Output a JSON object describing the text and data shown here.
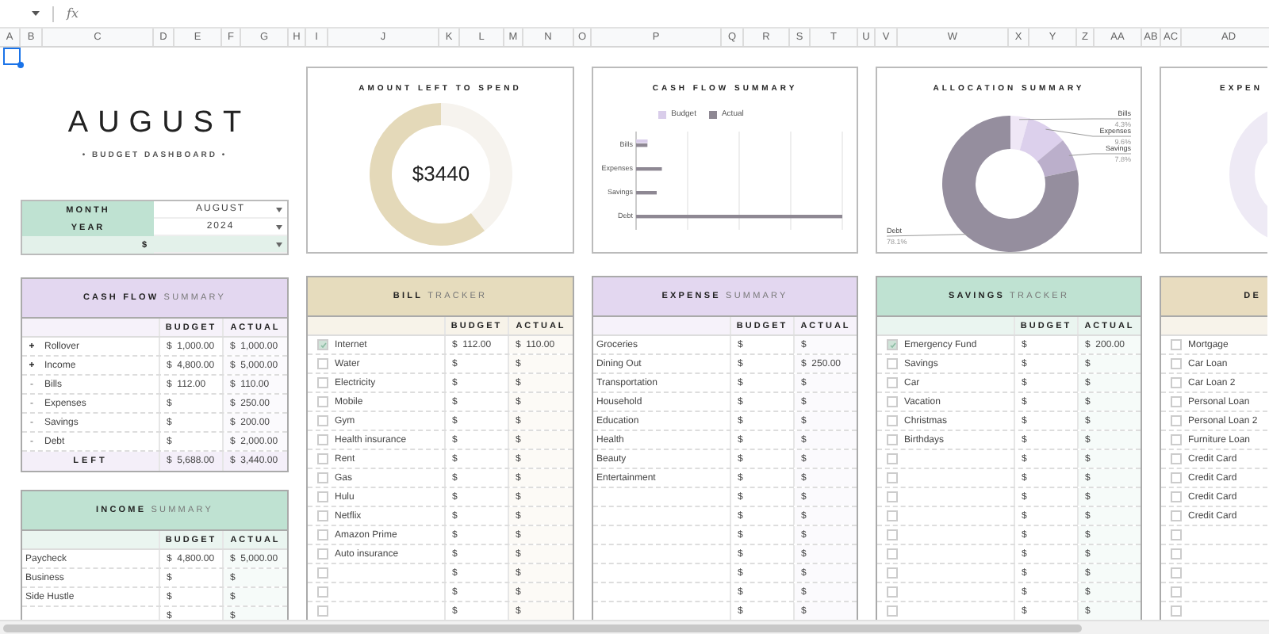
{
  "toolbar": {
    "formula_label": "fx"
  },
  "column_headers": [
    "A",
    "B",
    "C",
    "D",
    "E",
    "F",
    "G",
    "H",
    "I",
    "J",
    "K",
    "L",
    "M",
    "N",
    "O",
    "P",
    "Q",
    "R",
    "S",
    "T",
    "U",
    "V",
    "W",
    "X",
    "Y",
    "Z",
    "AA",
    "AB",
    "AC",
    "AD"
  ],
  "dashboard": {
    "title": "AUGUST",
    "subtitle": "• BUDGET DASHBOARD •",
    "selector": [
      {
        "kind": "field",
        "label": "MONTH",
        "value": "AUGUST"
      },
      {
        "kind": "field",
        "label": "YEAR",
        "value": "2024"
      },
      {
        "kind": "currency",
        "label": "$"
      }
    ]
  },
  "amount_card": {
    "title": "AMOUNT LEFT TO SPEND",
    "amount": "$3440"
  },
  "cashflow_chart": {
    "title": "CASH FLOW SUMMARY",
    "categories": [
      "Bills",
      "Expenses",
      "Savings",
      "Debt"
    ],
    "legend": [
      {
        "name": "Budget",
        "color": "#d9cdea"
      },
      {
        "name": "Actual",
        "color": "#8e8893"
      }
    ]
  },
  "allocation_chart": {
    "chart_data": {
      "type": "donut",
      "title": "ALLOCATION SUMMARY",
      "categories": [
        "Bills",
        "Expenses",
        "Savings",
        "Debt"
      ],
      "values": [
        4.3,
        9.6,
        7.8,
        78.1
      ],
      "value_labels": [
        "4.3%",
        "9.6%",
        "7.8%",
        "78.1%"
      ]
    }
  },
  "expense_chart": {
    "title": "EXPEN"
  },
  "tables": [
    {
      "kind": "summary",
      "color": "#e3d7f0",
      "title": "**CASH FLOW** SUMMARY",
      "columns": [
        "BUDGET",
        "ACTUAL"
      ],
      "rows": [
        {
          "marker": "+",
          "label": "Rollover",
          "budget": "$  1,000.00",
          "actual": "$  1,000.00"
        },
        {
          "marker": "+",
          "label": "Income",
          "budget": "$  4,800.00",
          "actual": "$  5,000.00"
        },
        {
          "marker": "-",
          "label": "Bills",
          "budget": "$  112.00",
          "actual": "$  110.00"
        },
        {
          "marker": "-",
          "label": "Expenses",
          "budget": "$",
          "actual": "$  250.00"
        },
        {
          "marker": "-",
          "label": "Savings",
          "budget": "$",
          "actual": "$  200.00"
        },
        {
          "marker": "-",
          "label": "Debt",
          "budget": "$",
          "actual": "$  2,000.00"
        }
      ],
      "footer": {
        "label": "LEFT",
        "budget": "$  5,688.00",
        "actual": "$  3,440.00"
      }
    },
    {
      "kind": "summary",
      "color": "#bfe2d2",
      "title": "**INCOME** SUMMARY",
      "columns": [
        "BUDGET",
        "ACTUAL"
      ],
      "rows": [
        {
          "label": "Paycheck",
          "budget": "$  4,800.00",
          "actual": "$  5,000.00"
        },
        {
          "label": "Business",
          "budget": "$",
          "actual": "$"
        },
        {
          "label": "Side Hustle",
          "budget": "$",
          "actual": "$"
        },
        {
          "budget": "$",
          "actual": "$"
        }
      ]
    },
    {
      "kind": "tracker",
      "color": "#e6dcbd",
      "title": "**BILL** TRACKER",
      "columns": [
        "BUDGET",
        "ACTUAL"
      ],
      "rows": [
        {
          "checked": true,
          "label": "Internet",
          "budget": "$  112.00",
          "actual": "$  110.00"
        },
        {
          "checked": false,
          "label": "Water",
          "budget": "$",
          "actual": "$"
        },
        {
          "checked": false,
          "label": "Electricity",
          "budget": "$",
          "actual": "$"
        },
        {
          "checked": false,
          "label": "Mobile",
          "budget": "$",
          "actual": "$"
        },
        {
          "checked": false,
          "label": "Gym",
          "budget": "$",
          "actual": "$"
        },
        {
          "checked": false,
          "label": "Health insurance",
          "budget": "$",
          "actual": "$"
        },
        {
          "checked": false,
          "label": "Rent",
          "budget": "$",
          "actual": "$"
        },
        {
          "checked": false,
          "label": "Gas",
          "budget": "$",
          "actual": "$"
        },
        {
          "checked": false,
          "label": "Hulu",
          "budget": "$",
          "actual": "$"
        },
        {
          "checked": false,
          "label": "Netflix",
          "budget": "$",
          "actual": "$"
        },
        {
          "checked": false,
          "label": "Amazon Prime",
          "budget": "$",
          "actual": "$"
        },
        {
          "checked": false,
          "label": "Auto insurance",
          "budget": "$",
          "actual": "$"
        },
        {
          "checked": false,
          "budget": "$",
          "actual": "$"
        },
        {
          "checked": false,
          "budget": "$",
          "actual": "$"
        },
        {
          "checked": false,
          "budget": "$",
          "actual": "$"
        }
      ]
    },
    {
      "kind": "summary",
      "color": "#e3d7f0",
      "title": "**EXPENSE** SUMMARY",
      "columns": [
        "BUDGET",
        "ACTUAL"
      ],
      "rows": [
        {
          "label": "Groceries",
          "budget": "$",
          "actual": "$"
        },
        {
          "label": "Dining Out",
          "budget": "$",
          "actual": "$  250.00"
        },
        {
          "label": "Transportation",
          "budget": "$",
          "actual": "$"
        },
        {
          "label": "Household",
          "budget": "$",
          "actual": "$"
        },
        {
          "label": "Education",
          "budget": "$",
          "actual": "$"
        },
        {
          "label": "Health",
          "budget": "$",
          "actual": "$"
        },
        {
          "label": "Beauty",
          "budget": "$",
          "actual": "$"
        },
        {
          "label": "Entertainment",
          "budget": "$",
          "actual": "$"
        },
        {
          "budget": "$",
          "actual": "$"
        },
        {
          "budget": "$",
          "actual": "$"
        },
        {
          "budget": "$",
          "actual": "$"
        },
        {
          "budget": "$",
          "actual": "$"
        },
        {
          "budget": "$",
          "actual": "$"
        },
        {
          "budget": "$",
          "actual": "$"
        },
        {
          "budget": "$",
          "actual": "$"
        }
      ]
    },
    {
      "kind": "tracker",
      "color": "#bfe2d2",
      "title": "**SAVINGS** TRACKER",
      "columns": [
        "BUDGET",
        "ACTUAL"
      ],
      "rows": [
        {
          "checked": true,
          "label": "Emergency Fund",
          "budget": "$",
          "actual": "$  200.00"
        },
        {
          "checked": false,
          "label": "Savings",
          "budget": "$",
          "actual": "$"
        },
        {
          "checked": false,
          "label": "Car",
          "budget": "$",
          "actual": "$"
        },
        {
          "checked": false,
          "label": "Vacation",
          "budget": "$",
          "actual": "$"
        },
        {
          "checked": false,
          "label": "Christmas",
          "budget": "$",
          "actual": "$"
        },
        {
          "checked": false,
          "label": "Birthdays",
          "budget": "$",
          "actual": "$"
        },
        {
          "checked": false,
          "budget": "$",
          "actual": "$"
        },
        {
          "checked": false,
          "budget": "$",
          "actual": "$"
        },
        {
          "checked": false,
          "budget": "$",
          "actual": "$"
        },
        {
          "checked": false,
          "budget": "$",
          "actual": "$"
        },
        {
          "checked": false,
          "budget": "$",
          "actual": "$"
        },
        {
          "checked": false,
          "budget": "$",
          "actual": "$"
        },
        {
          "checked": false,
          "budget": "$",
          "actual": "$"
        },
        {
          "checked": false,
          "budget": "$",
          "actual": "$"
        },
        {
          "checked": false,
          "budget": "$",
          "actual": "$"
        }
      ]
    },
    {
      "kind": "tracker",
      "color": "#e8dcbf",
      "title": "**DE**",
      "rows": [
        {
          "checked": false,
          "label": "Mortgage"
        },
        {
          "checked": false,
          "label": "Car Loan"
        },
        {
          "checked": false,
          "label": "Car Loan 2"
        },
        {
          "checked": false,
          "label": "Personal Loan"
        },
        {
          "checked": false,
          "label": "Personal Loan 2"
        },
        {
          "checked": false,
          "label": "Furniture Loan"
        },
        {
          "checked": false,
          "label": "Credit Card"
        },
        {
          "checked": false,
          "label": "Credit Card"
        },
        {
          "checked": false,
          "label": "Credit Card"
        },
        {
          "checked": false,
          "label": "Credit Card"
        },
        {
          "checked": false
        },
        {
          "checked": false
        },
        {
          "checked": false
        },
        {
          "checked": false
        },
        {
          "checked": false
        }
      ]
    }
  ]
}
